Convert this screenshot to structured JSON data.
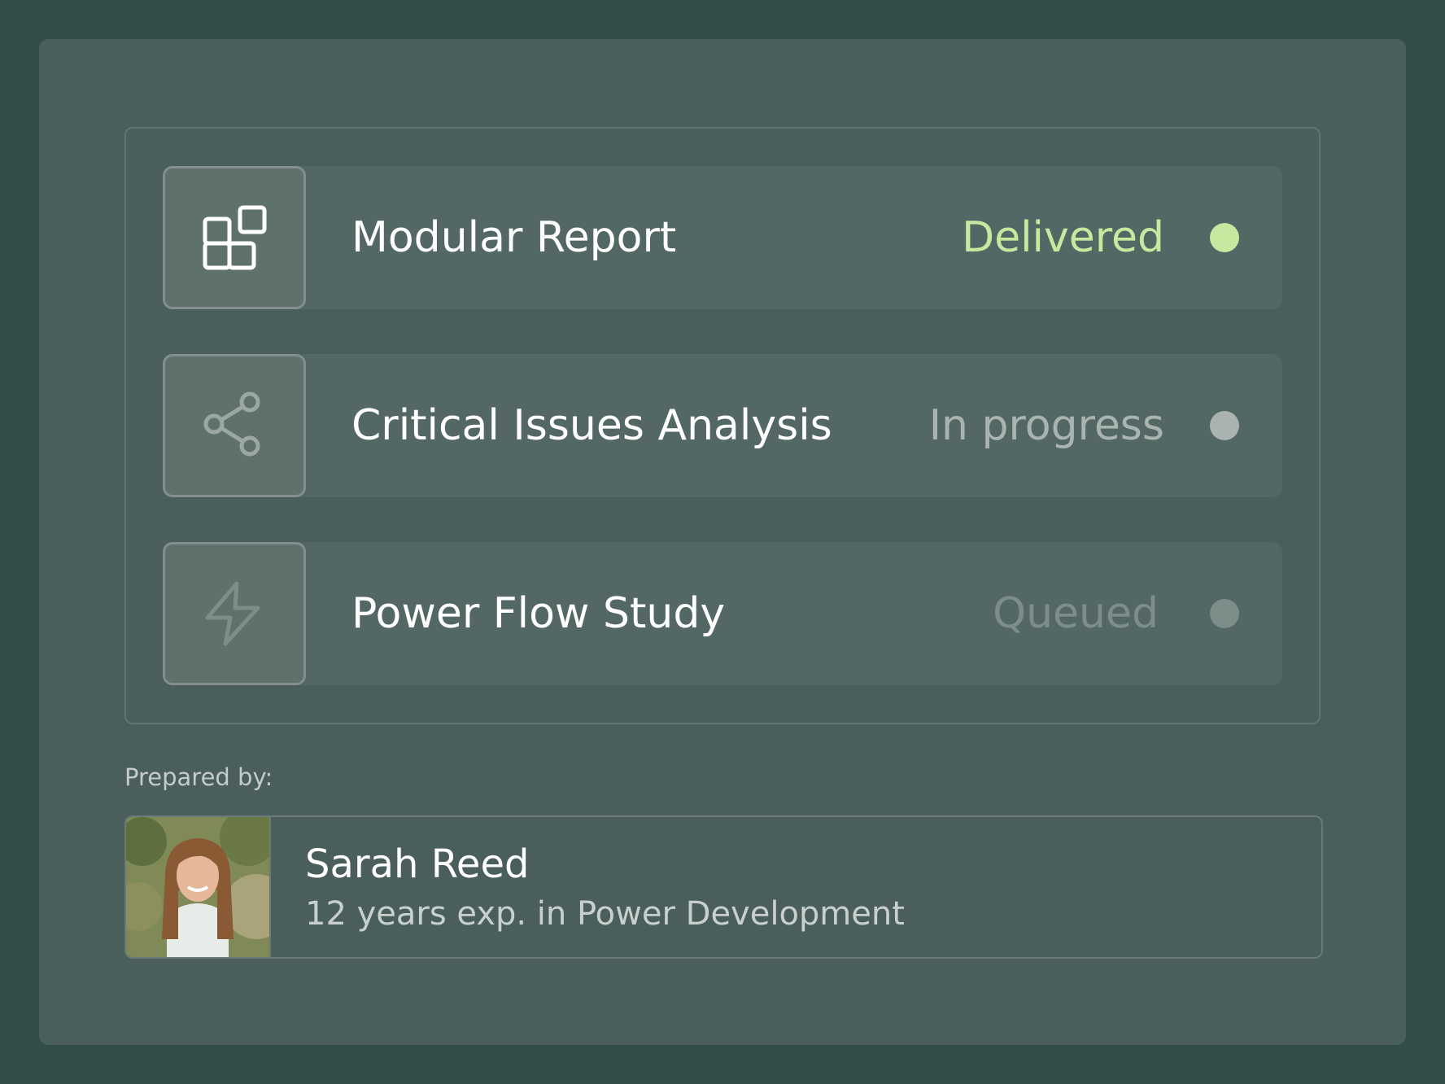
{
  "reports": [
    {
      "title": "Modular Report",
      "status": "Delivered",
      "icon": "modules-icon",
      "status_color": "#c6e89f",
      "dot_color": "#c6e89f",
      "icon_color": "#ffffff"
    },
    {
      "title": "Critical Issues Analysis",
      "status": "In progress",
      "icon": "share-icon",
      "status_color": "#a9b4b1",
      "dot_color": "#a9b4b1",
      "icon_color": "#9aa7a4"
    },
    {
      "title": "Power Flow Study",
      "status": "Queued",
      "icon": "lightning-icon",
      "status_color": "#7d8d89",
      "dot_color": "#7d8d89",
      "icon_color": "#7d8d89"
    }
  ],
  "prepared_by": {
    "label": "Prepared by:",
    "name": "Sarah Reed",
    "experience": "12 years exp. in Power Development"
  }
}
